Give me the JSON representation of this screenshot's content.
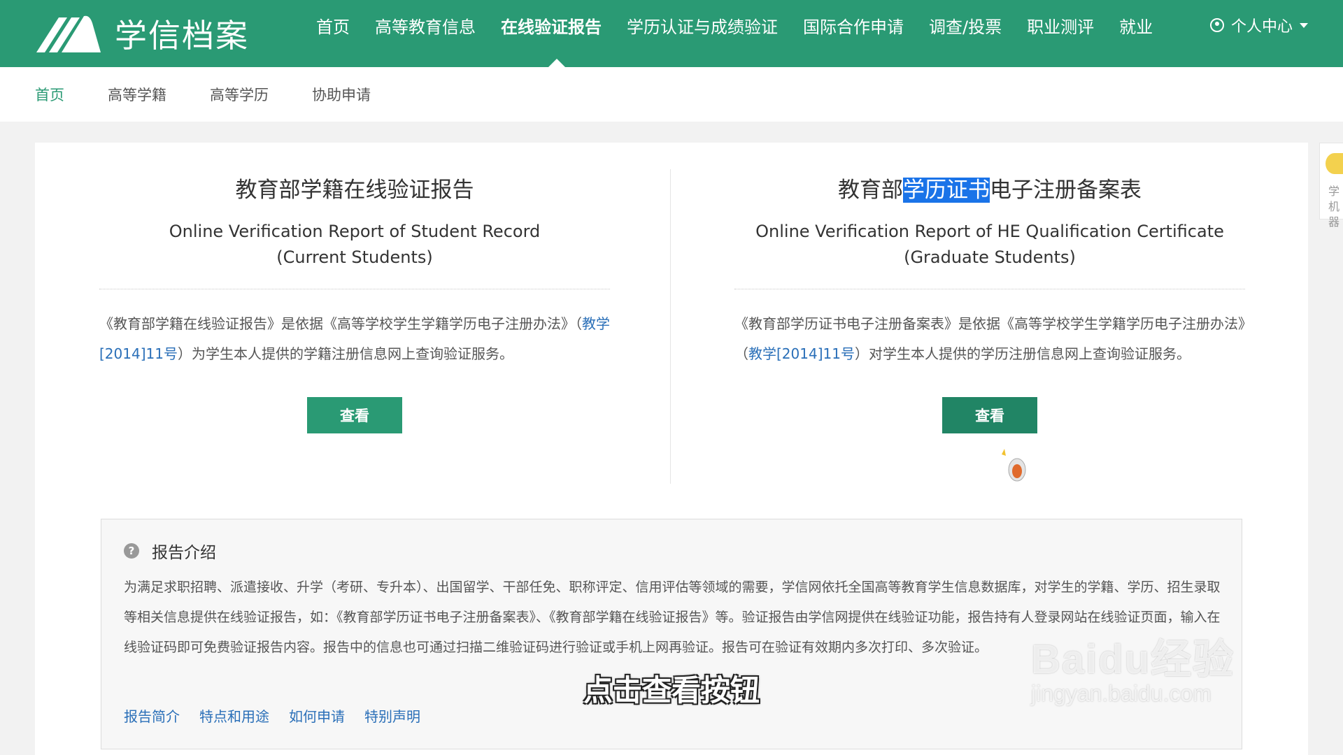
{
  "brand": {
    "name": "学信档案"
  },
  "nav": {
    "items": [
      "首页",
      "高等教育信息",
      "在线验证报告",
      "学历认证与成绩验证",
      "国际合作申请",
      "调查/投票",
      "职业测评",
      "就业"
    ],
    "active": "在线验证报告",
    "user_label": "个人中心"
  },
  "subnav": {
    "items": [
      "首页",
      "高等学籍",
      "高等学历",
      "协助申请"
    ],
    "active": "首页"
  },
  "left_card": {
    "title_cn": "教育部学籍在线验证报告",
    "title_en_line1": "Online Verification Report of Student Record",
    "title_en_line2": "(Current Students)",
    "desc_before": "《教育部学籍在线验证报告》是依据《高等学校学生学籍学历电子注册办法》（",
    "desc_link": "教学[2014]11号",
    "desc_after": "）为学生本人提供的学籍注册信息网上查询验证服务。",
    "button": "查看"
  },
  "right_card": {
    "title_cn_pre": "教育部",
    "title_cn_highlight": "学历证书",
    "title_cn_post": "电子注册备案表",
    "title_en_line1": "Online Verification Report of HE Qualification Certificate",
    "title_en_line2": "(Graduate Students)",
    "desc_before": "《教育部学历证书电子注册备案表》是依据《高等学校学生学籍学历电子注册办法》（",
    "desc_link": "教学[2014]11号",
    "desc_after": "）对学生本人提供的学历注册信息网上查询验证服务。",
    "button": "查看"
  },
  "intro": {
    "heading": "报告介绍",
    "body": "为满足求职招聘、派遣接收、升学（考研、专升本）、出国留学、干部任免、职称评定、信用评估等领域的需要，学信网依托全国高等教育学生信息数据库，对学生的学籍、学历、招生录取等相关信息提供在线验证报告，如：《教育部学历证书电子注册备案表》、《教育部学籍在线验证报告》等。验证报告由学信网提供在线验证功能，报告持有人登录网站在线验证页面，输入在线验证码即可免费验证报告内容。报告中的信息也可通过扫描二维验证码进行验证或手机上网再验证。报告可在验证有效期内多次打印、多次验证。",
    "links": [
      "报告简介",
      "特点和用途",
      "如何申请",
      "特别声明"
    ]
  },
  "side_widget": {
    "text_line1": "学",
    "text_line2": "机器"
  },
  "watermark": {
    "line1": "Baidu经验",
    "line2": "jingyan.baidu.com"
  },
  "caption": "点击查看按钮",
  "colors": {
    "brand_green": "#2a9a74",
    "link_blue": "#2a6fb8",
    "highlight": "#1a73e8"
  }
}
